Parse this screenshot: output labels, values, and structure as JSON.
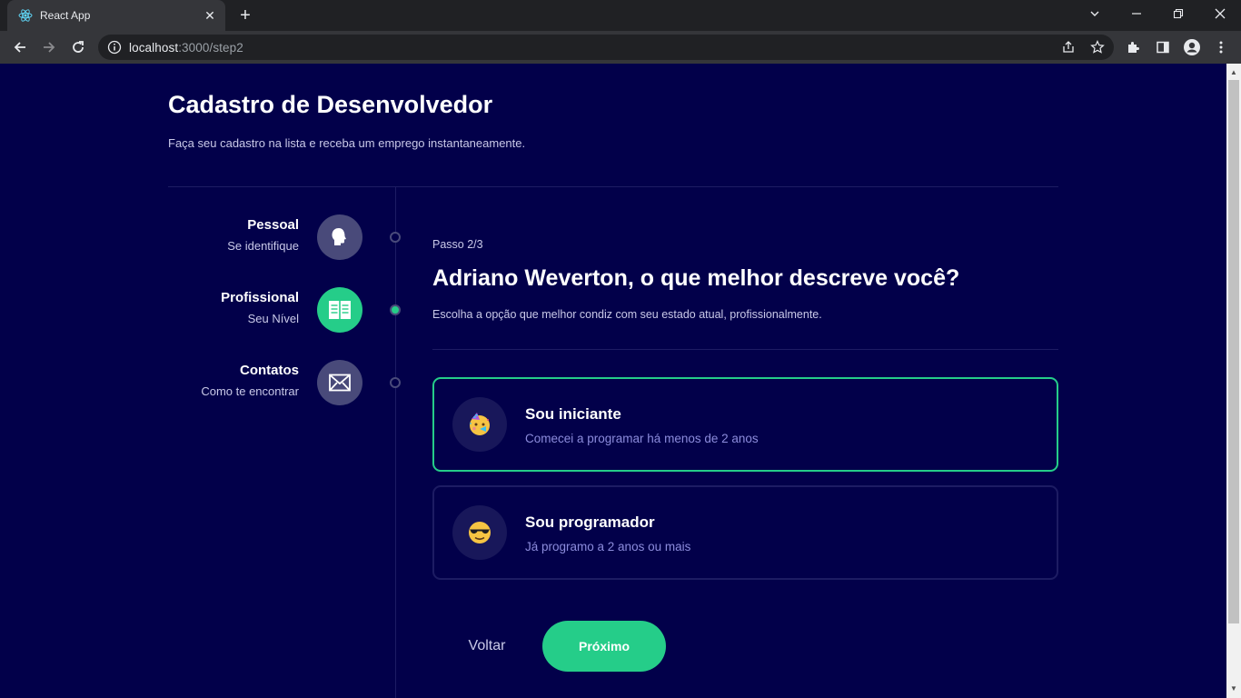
{
  "browser": {
    "tab_title": "React App",
    "url_host": "localhost",
    "url_path": ":3000/step2"
  },
  "page": {
    "title": "Cadastro de Desenvolvedor",
    "subtitle": "Faça seu cadastro na lista e receba um emprego instantaneamente."
  },
  "steps": [
    {
      "title": "Pessoal",
      "subtitle": "Se identifique",
      "icon": "user-head-icon",
      "active": false
    },
    {
      "title": "Profissional",
      "subtitle": "Seu Nível",
      "icon": "book-icon",
      "active": true
    },
    {
      "title": "Contatos",
      "subtitle": "Como te encontrar",
      "icon": "mail-icon",
      "active": false
    }
  ],
  "form": {
    "step_label": "Passo 2/3",
    "question": "Adriano Weverton, o que melhor descreve você?",
    "question_sub": "Escolha a opção que melhor condiz com seu estado atual, profissionalmente."
  },
  "options": [
    {
      "title": "Sou iniciante",
      "description": "Comecei a programar há menos de 2 anos",
      "icon": "party-face-icon",
      "selected": true
    },
    {
      "title": "Sou programador",
      "description": "Já programo a 2 anos ou mais",
      "icon": "sunglasses-face-icon",
      "selected": false
    }
  ],
  "buttons": {
    "back": "Voltar",
    "next": "Próximo"
  },
  "colors": {
    "background": "#02004a",
    "accent": "#25cd89",
    "step_inactive": "#494a7a",
    "border": "#1d1c63"
  }
}
